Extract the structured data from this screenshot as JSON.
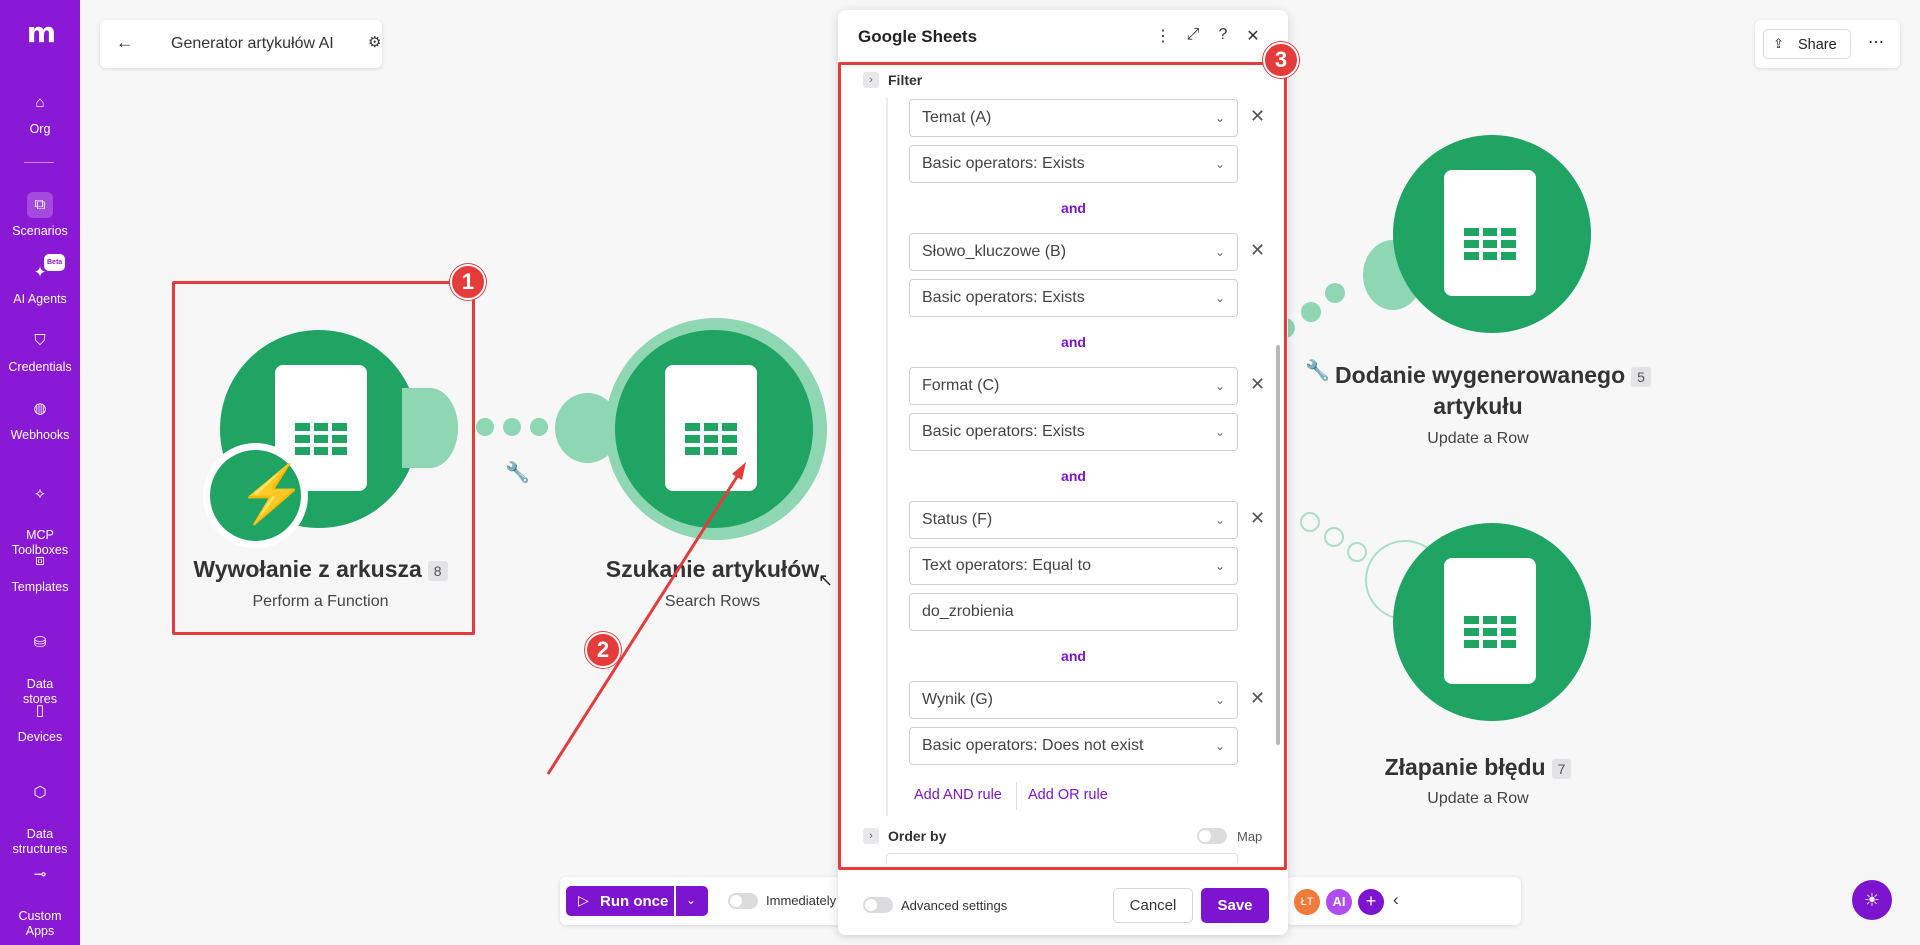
{
  "sidebar": {
    "logo": "m",
    "items": [
      {
        "label": "Org",
        "icon": "⌂"
      },
      {
        "label": "Scenarios",
        "icon": "⧉"
      },
      {
        "label": "AI Agents",
        "icon": "✦",
        "badge": "Beta"
      },
      {
        "label": "Credentials",
        "icon": "⛉"
      },
      {
        "label": "Webhooks",
        "icon": "◍"
      },
      {
        "label": "MCP\nToolboxes",
        "icon": "⟡"
      },
      {
        "label": "Templates",
        "icon": "⧈"
      },
      {
        "label": "Data\nstores",
        "icon": "⛁"
      },
      {
        "label": "Devices",
        "icon": "▯"
      },
      {
        "label": "Data\nstructures",
        "icon": "⬡"
      },
      {
        "label": "Custom\nApps",
        "icon": "⊸"
      }
    ]
  },
  "header": {
    "title": "Generator artykułów AI",
    "share_label": "Share"
  },
  "nodes": {
    "node1": {
      "title": "Wywołanie z arkusza",
      "badge": "8",
      "subtitle": "Perform a Function"
    },
    "node2": {
      "title": "Szukanie artykułów",
      "subtitle": "Search Rows"
    },
    "node3": {
      "title": "Dodanie wygenerowanego",
      "title2": "artykułu",
      "badge": "5",
      "subtitle": "Update a Row"
    },
    "node4": {
      "title": "Złapanie błędu",
      "badge": "7",
      "subtitle": "Update a Row"
    }
  },
  "annotations": {
    "n1": "1",
    "n2": "2",
    "n3": "3"
  },
  "panel": {
    "title": "Google Sheets",
    "filter_label": "Filter",
    "rules": [
      {
        "field": "Temat (A)",
        "operator": "Basic operators: Exists"
      },
      {
        "field": "Słowo_kluczowe (B)",
        "operator": "Basic operators: Exists"
      },
      {
        "field": "Format (C)",
        "operator": "Basic operators: Exists"
      },
      {
        "field": "Status (F)",
        "operator": "Text operators: Equal to",
        "value": "do_zrobienia"
      },
      {
        "field": "Wynik (G)",
        "operator": "Basic operators: Does not exist"
      }
    ],
    "and_label": "and",
    "add_and": "Add AND rule",
    "add_or": "Add OR rule",
    "order_by": "Order by",
    "map_label": "Map",
    "advanced": "Advanced settings",
    "cancel": "Cancel",
    "save": "Save"
  },
  "bottombar": {
    "run_once": "Run once",
    "immediately": "Immediately",
    "avatar_initials": "ŁT",
    "ai_label": "AI"
  },
  "colors": {
    "brand": "#8a19d6",
    "sheets_green": "#1fa463",
    "annotation_red": "#e63b3b"
  }
}
